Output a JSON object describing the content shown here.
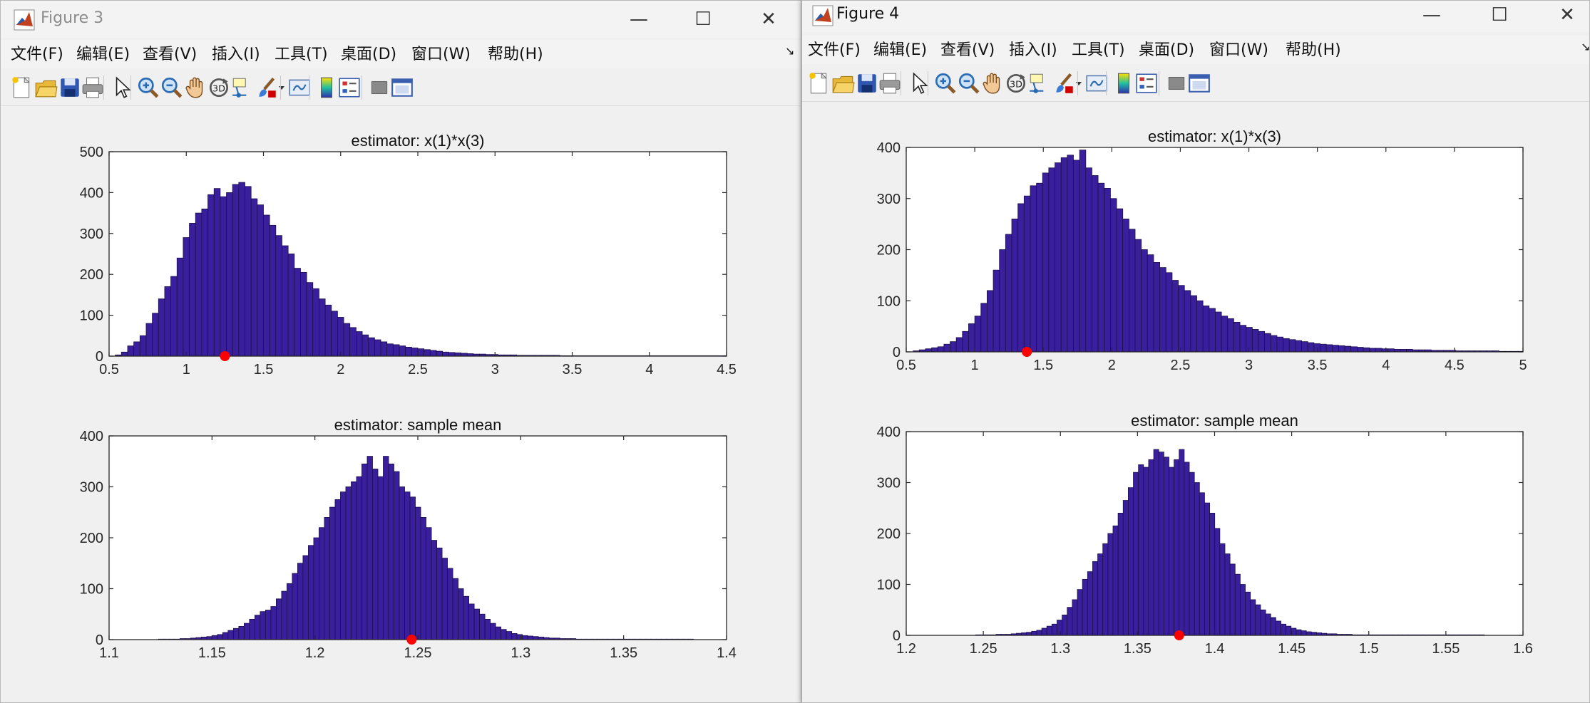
{
  "colors": {
    "bar_fill": "#3a1f9c",
    "bar_edge": "#1c0f4a",
    "marker": "#ff0000",
    "axis": "#262626"
  },
  "icons": {
    "toolbar": [
      "new-figure-icon",
      "open-file-icon",
      "save-icon",
      "print-icon",
      "pointer-icon",
      "zoom-in-icon",
      "zoom-out-icon",
      "pan-hand-icon",
      "rotate-3d-icon",
      "data-cursor-icon",
      "brush-icon",
      "brush-dropdown-icon",
      "link-plot-icon",
      "colorbar-icon",
      "legend-icon",
      "hide-plot-tools-icon",
      "show-plot-tools-icon"
    ],
    "logo": "matlab-logo-icon",
    "window_controls": [
      "minimize-icon",
      "maximize-icon",
      "close-icon"
    ]
  },
  "window1": {
    "title": "Figure 3",
    "menus": [
      "文件(F)",
      "编辑(E)",
      "查看(V)",
      "插入(I)",
      "工具(T)",
      "桌面(D)",
      "窗口(W)",
      "帮助(H)"
    ],
    "overflow_glyph": "↘"
  },
  "window2": {
    "title": "Figure 4",
    "menus": [
      "文件(F)",
      "编辑(E)",
      "查看(V)",
      "插入(I)",
      "工具(T)",
      "桌面(D)",
      "窗口(W)",
      "帮助(H)"
    ],
    "overflow_glyph": "↘"
  },
  "chart_data": [
    {
      "type": "bar",
      "id": "fig3-top",
      "title": "estimator: x(1)*x(3)",
      "xlim": [
        0.5,
        4.5
      ],
      "ylim": [
        0,
        500
      ],
      "xticks": [
        "0.5",
        "1",
        "1.5",
        "2",
        "2.5",
        "3",
        "3.5",
        "4",
        "4.5"
      ],
      "yticks": [
        "0",
        "100",
        "200",
        "300",
        "400",
        "500"
      ],
      "bin_start": 0.54,
      "bin_width": 0.04,
      "values": [
        3,
        10,
        25,
        35,
        50,
        80,
        105,
        140,
        170,
        195,
        240,
        290,
        325,
        350,
        360,
        395,
        410,
        390,
        400,
        420,
        425,
        415,
        385,
        370,
        345,
        320,
        295,
        270,
        250,
        215,
        205,
        180,
        165,
        140,
        125,
        110,
        95,
        80,
        70,
        60,
        52,
        45,
        40,
        35,
        30,
        28,
        25,
        22,
        20,
        18,
        16,
        14,
        12,
        10,
        9,
        8,
        7,
        6,
        5,
        5,
        4,
        4,
        3,
        3,
        3,
        2,
        2,
        2,
        2,
        2,
        2,
        2,
        1,
        1,
        1,
        1,
        1,
        1,
        1,
        1,
        1,
        1,
        1,
        1,
        1,
        1,
        1,
        1,
        1,
        1,
        1,
        1,
        1,
        1,
        1,
        1,
        1,
        1,
        1,
        1
      ],
      "marker": {
        "x": 1.25,
        "y": 0
      }
    },
    {
      "type": "bar",
      "id": "fig3-bottom",
      "title": "estimator: sample mean",
      "xlim": [
        1.1,
        1.4
      ],
      "ylim": [
        0,
        400
      ],
      "xticks": [
        "1.1",
        "1.15",
        "1.2",
        "1.25",
        "1.3",
        "1.35",
        "1.4"
      ],
      "yticks": [
        "0",
        "100",
        "200",
        "300",
        "400"
      ],
      "bin_start": 1.124,
      "bin_width": 0.0026,
      "values": [
        1,
        1,
        1,
        1,
        2,
        2,
        3,
        4,
        5,
        6,
        8,
        10,
        14,
        18,
        22,
        26,
        32,
        40,
        48,
        55,
        58,
        65,
        80,
        95,
        110,
        130,
        150,
        165,
        185,
        200,
        220,
        240,
        260,
        275,
        290,
        300,
        310,
        320,
        345,
        360,
        335,
        320,
        360,
        345,
        330,
        300,
        290,
        280,
        260,
        240,
        220,
        195,
        180,
        160,
        140,
        120,
        100,
        85,
        70,
        60,
        50,
        40,
        32,
        25,
        20,
        16,
        12,
        10,
        8,
        7,
        6,
        5,
        4,
        3,
        3,
        2,
        2,
        2,
        1,
        1,
        1,
        1,
        1,
        1,
        1,
        1,
        1,
        1,
        1,
        1,
        1,
        1,
        1,
        1,
        1,
        1,
        1,
        1,
        1,
        1
      ],
      "marker": {
        "x": 1.247,
        "y": 0
      }
    },
    {
      "type": "bar",
      "id": "fig4-top",
      "title": "estimator: x(1)*x(3)",
      "xlim": [
        0.5,
        5
      ],
      "ylim": [
        0,
        400
      ],
      "xticks": [
        "0.5",
        "1",
        "1.5",
        "2",
        "2.5",
        "3",
        "3.5",
        "4",
        "4.5",
        "5"
      ],
      "yticks": [
        "0",
        "100",
        "200",
        "300",
        "400"
      ],
      "bin_start": 0.55,
      "bin_width": 0.045,
      "values": [
        2,
        4,
        6,
        8,
        10,
        15,
        20,
        28,
        40,
        55,
        70,
        95,
        120,
        160,
        200,
        230,
        260,
        290,
        305,
        325,
        330,
        350,
        360,
        370,
        380,
        385,
        375,
        395,
        360,
        345,
        330,
        320,
        300,
        280,
        260,
        240,
        220,
        200,
        190,
        175,
        165,
        155,
        140,
        130,
        120,
        110,
        100,
        90,
        85,
        78,
        70,
        65,
        58,
        52,
        48,
        44,
        40,
        36,
        32,
        29,
        26,
        24,
        22,
        20,
        18,
        16,
        15,
        14,
        13,
        12,
        11,
        10,
        9,
        8,
        7,
        7,
        6,
        6,
        5,
        5,
        5,
        4,
        4,
        4,
        3,
        3,
        3,
        3,
        2,
        2,
        2,
        2,
        2,
        2,
        2,
        1,
        1,
        1,
        1,
        1
      ],
      "marker": {
        "x": 1.38,
        "y": 0
      }
    },
    {
      "type": "bar",
      "id": "fig4-bottom",
      "title": "estimator: sample mean",
      "xlim": [
        1.2,
        1.6
      ],
      "ylim": [
        0,
        400
      ],
      "xticks": [
        "1.2",
        "1.25",
        "1.3",
        "1.35",
        "1.4",
        "1.45",
        "1.5",
        "1.55",
        "1.6"
      ],
      "yticks": [
        "0",
        "100",
        "200",
        "300",
        "400"
      ],
      "bin_start": 1.245,
      "bin_width": 0.0033,
      "values": [
        1,
        1,
        1,
        1,
        2,
        2,
        2,
        3,
        4,
        5,
        6,
        8,
        10,
        14,
        18,
        22,
        30,
        40,
        55,
        70,
        90,
        110,
        125,
        145,
        160,
        180,
        200,
        215,
        240,
        265,
        290,
        320,
        335,
        330,
        345,
        365,
        360,
        350,
        330,
        345,
        365,
        340,
        320,
        300,
        280,
        260,
        240,
        210,
        180,
        160,
        140,
        120,
        100,
        85,
        70,
        60,
        50,
        42,
        35,
        28,
        22,
        18,
        14,
        11,
        9,
        7,
        6,
        5,
        4,
        3,
        3,
        2,
        2,
        2,
        1,
        1,
        1,
        1,
        1,
        1,
        1,
        1,
        1,
        1,
        1,
        1,
        1,
        1,
        1,
        1,
        1,
        1,
        1,
        1,
        1,
        1,
        1,
        1,
        1,
        1
      ],
      "marker": {
        "x": 1.377,
        "y": 0
      }
    }
  ]
}
